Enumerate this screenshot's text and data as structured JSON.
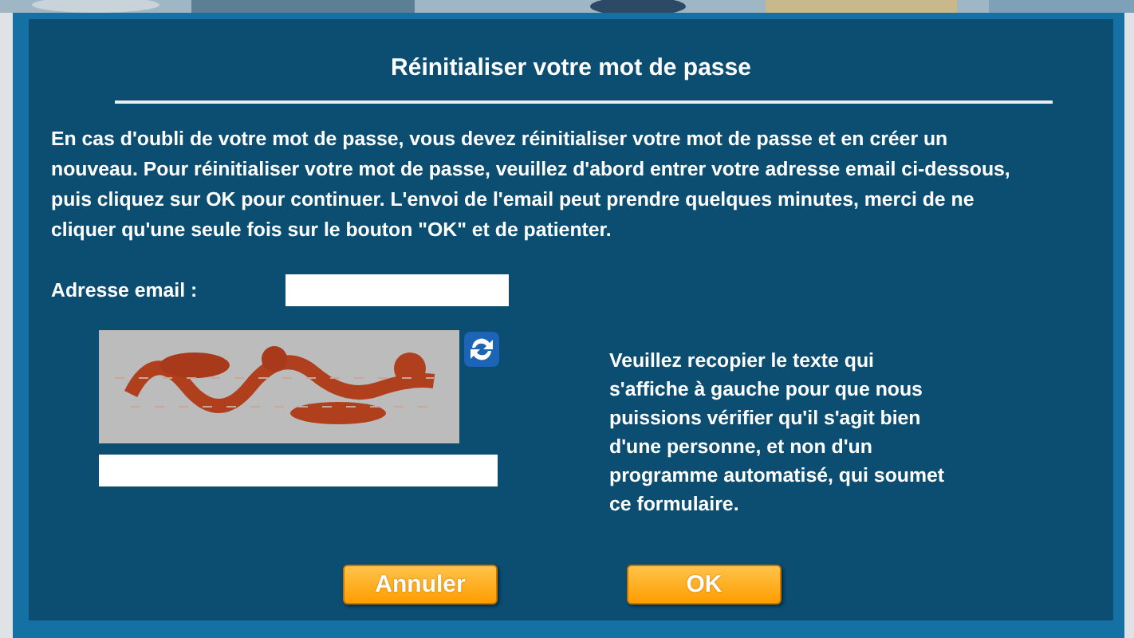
{
  "dialog": {
    "title": "Réinitialiser votre mot de passe",
    "intro": "En cas d'oubli de votre mot de passe, vous devez réinitialiser votre mot de passe et en créer un nouveau. Pour réinitialiser votre mot de passe, veuillez d'abord entrer votre adresse email ci-dessous, puis cliquez sur OK pour continuer. L'envoi de l'email peut prendre quelques minutes, merci de ne cliquer qu'une seule fois sur le bouton \"OK\" et de patienter.",
    "email_label": "Adresse email :",
    "captcha": {
      "kind": "picture",
      "hint": "Veuillez recopier le texte qui s'affiche à gauche pour que nous puissions vérifier qu'il s'agit bien d'une personne, et non d'un programme automatisé, qui soumet ce formulaire."
    },
    "buttons": [
      "Annuler",
      "OK"
    ]
  }
}
